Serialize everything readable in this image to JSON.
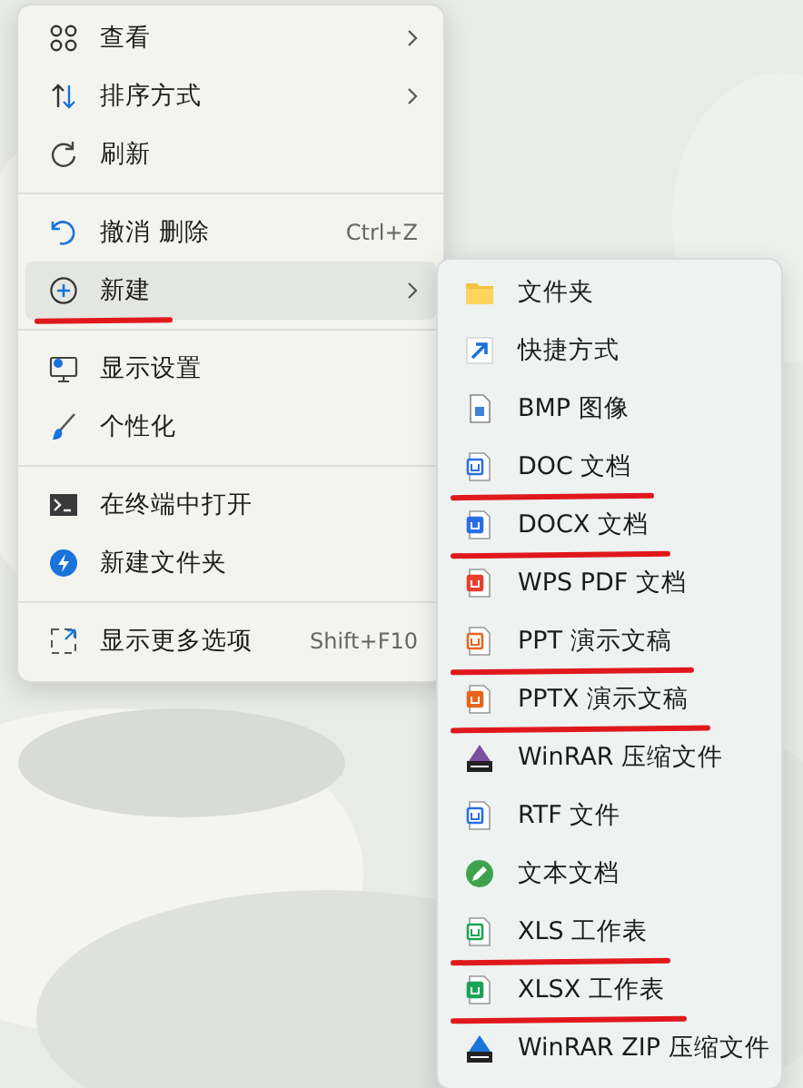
{
  "context_menu": {
    "groups": [
      [
        {
          "label": "查看",
          "submenu": true,
          "selected": false,
          "underlined": false
        },
        {
          "label": "排序方式",
          "submenu": true,
          "selected": false,
          "underlined": false
        },
        {
          "label": "刷新",
          "submenu": false,
          "selected": false,
          "underlined": false
        }
      ],
      [
        {
          "label": "撤消 删除",
          "shortcut": "Ctrl+Z",
          "submenu": false,
          "selected": false,
          "underlined": false
        },
        {
          "label": "新建",
          "submenu": true,
          "selected": true,
          "underlined": true
        }
      ],
      [
        {
          "label": "显示设置",
          "submenu": false,
          "selected": false,
          "underlined": false
        },
        {
          "label": "个性化",
          "submenu": false,
          "selected": false,
          "underlined": false
        }
      ],
      [
        {
          "label": "在终端中打开",
          "submenu": false,
          "selected": false,
          "underlined": false
        },
        {
          "label": "新建文件夹",
          "submenu": false,
          "selected": false,
          "underlined": false
        }
      ],
      [
        {
          "label": "显示更多选项",
          "shortcut": "Shift+F10",
          "submenu": false,
          "selected": false,
          "underlined": false
        }
      ]
    ]
  },
  "new_submenu": {
    "items": [
      {
        "label": "文件夹",
        "underlined": false
      },
      {
        "label": "快捷方式",
        "underlined": false
      },
      {
        "label": "BMP 图像",
        "underlined": false
      },
      {
        "label": "DOC 文档",
        "underlined": true
      },
      {
        "label": "DOCX 文档",
        "underlined": true
      },
      {
        "label": "WPS PDF 文档",
        "underlined": false
      },
      {
        "label": "PPT 演示文稿",
        "underlined": true
      },
      {
        "label": "PPTX 演示文稿",
        "underlined": true
      },
      {
        "label": "WinRAR 压缩文件",
        "underlined": false
      },
      {
        "label": "RTF 文件",
        "underlined": false
      },
      {
        "label": "文本文档",
        "underlined": false
      },
      {
        "label": "XLS 工作表",
        "underlined": true
      },
      {
        "label": "XLSX 工作表",
        "underlined": true
      },
      {
        "label": "WinRAR ZIP 压缩文件",
        "underlined": false
      }
    ]
  }
}
